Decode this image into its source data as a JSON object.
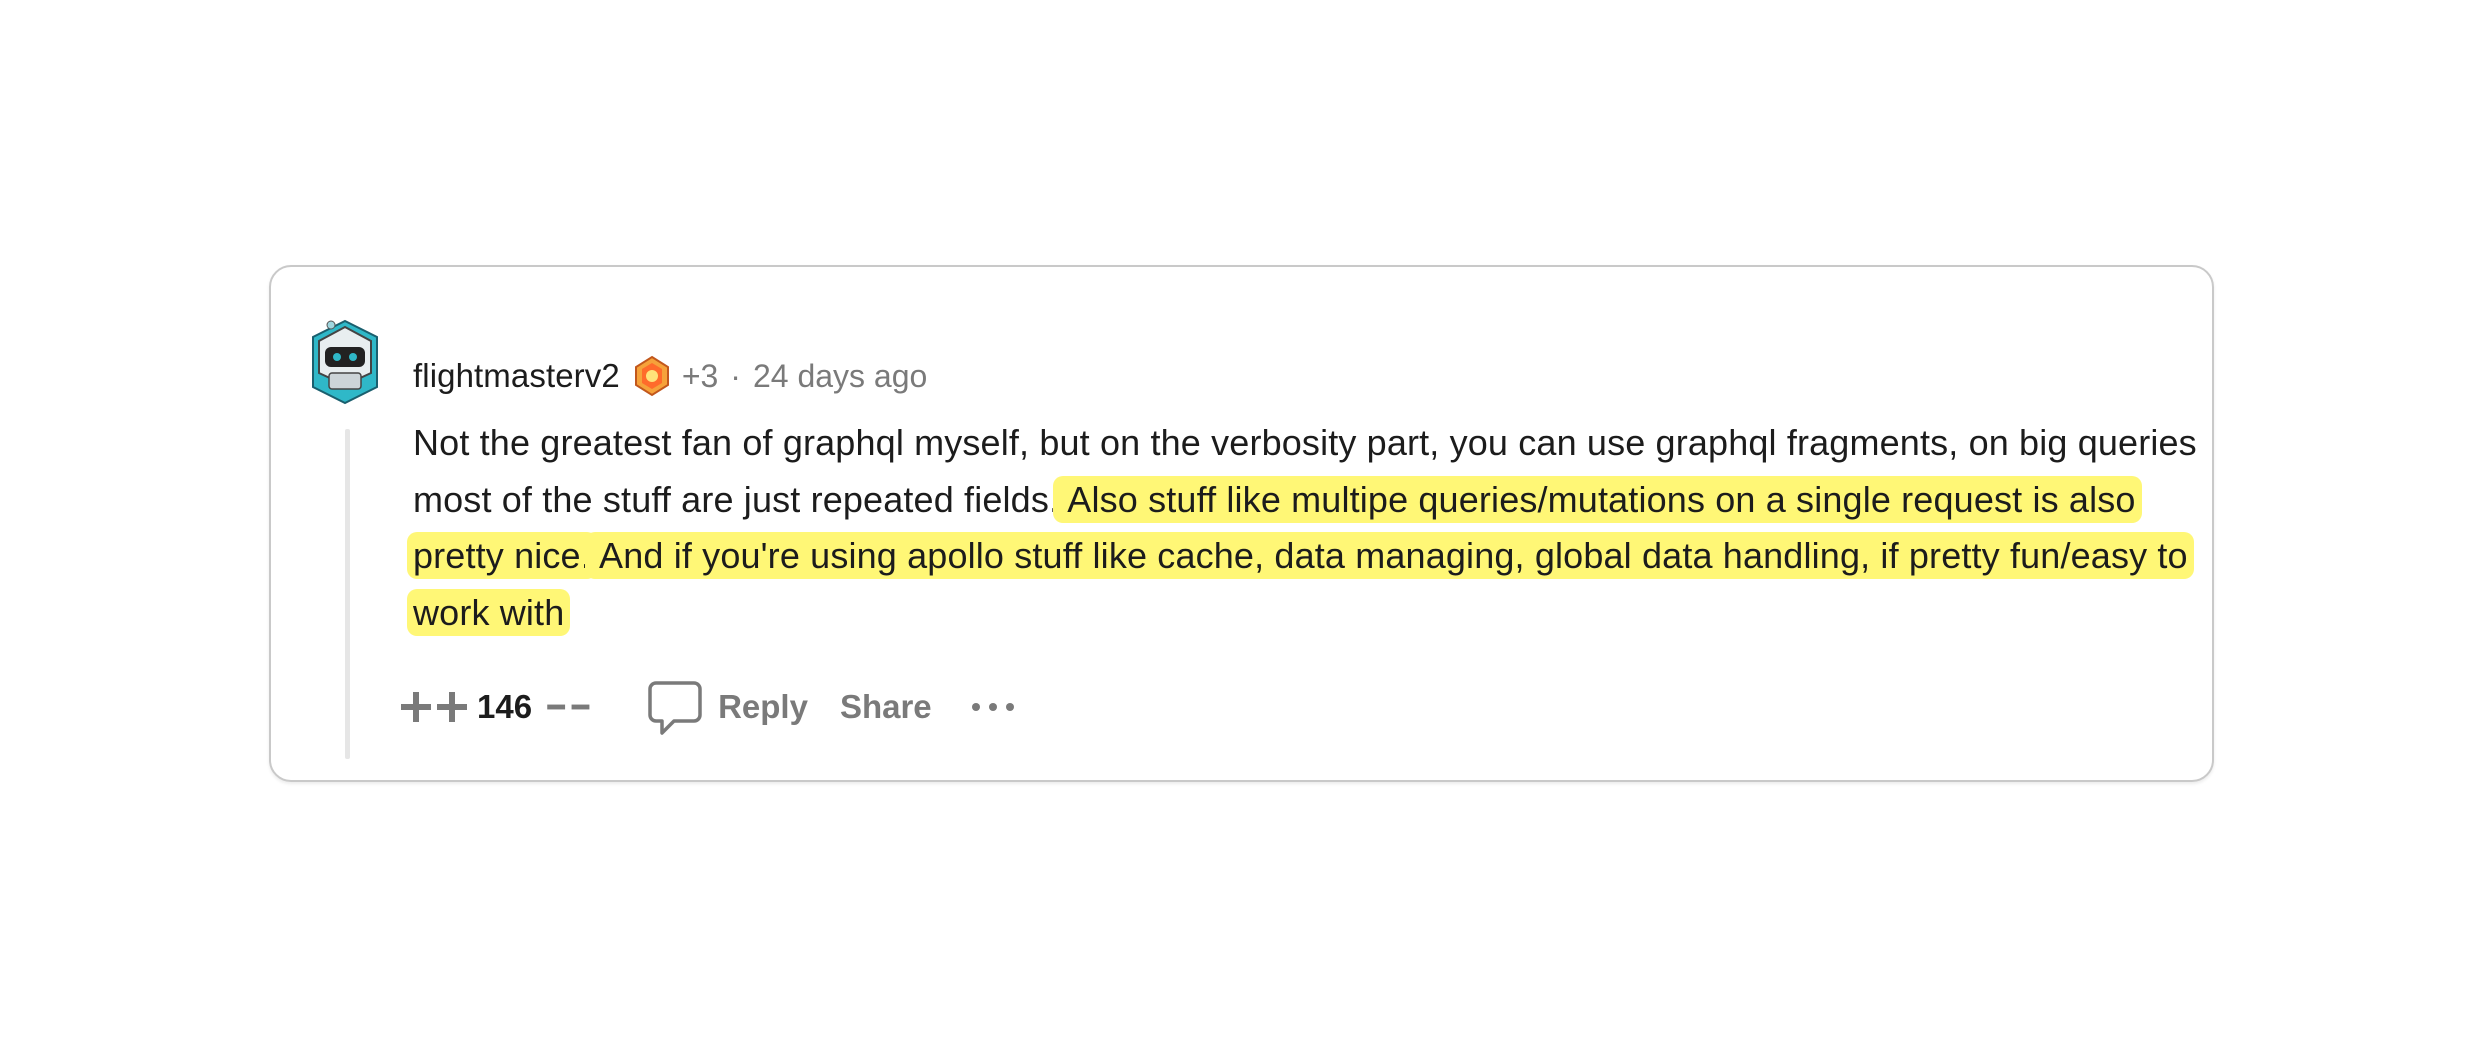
{
  "comment": {
    "username": "flightmasterv2",
    "extra_karma": "+3",
    "separator": "·",
    "timestamp": "24 days ago",
    "body_plain": "Not the greatest fan of graphql myself, but on the verbosity part, you can use graphql fragments, on big queries most of the stuff are just repeated fields.",
    "body_highlight_1": " Also stuff like multipe queries/mutations on a single request is also pretty nice.",
    "body_highlight_2": " And if you're using apollo stuff like cache, data managing, global data handling, if pretty fun/easy to work with",
    "score": "146",
    "reply_label": "Reply",
    "share_label": "Share"
  },
  "icons": {
    "avatar": "avatar-image",
    "flair": "flair-badge-icon",
    "upvote": "double-plus-icon",
    "downvote": "double-minus-icon",
    "reply": "comment-bubble-icon",
    "more": "more-dots-icon"
  },
  "colors": {
    "highlight": "#fff776",
    "muted_text": "#7a7a7a",
    "body_text": "#1c1c1c",
    "border": "#c9c9c9"
  }
}
